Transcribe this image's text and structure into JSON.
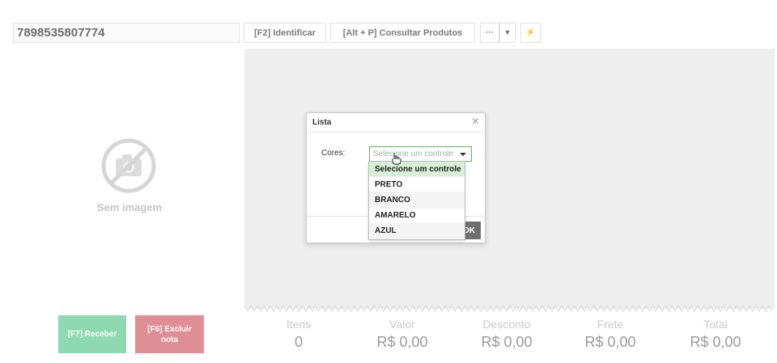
{
  "toolbar": {
    "barcode_value": "7898535807774",
    "identify_label": "[F2] Identificar",
    "consult_label": "[Alt + P] Consultar Produtos",
    "more_label": "···",
    "caret_label": "▾",
    "bolt_label": "⚡"
  },
  "image_area": {
    "no_image_label": "Sem imagem",
    "icon": "no-image-camera-icon"
  },
  "actions": {
    "receive_label": "[F7] Receber",
    "delete_label": "[F6] Excluir nota",
    "receive_color": "#8fd9b0",
    "delete_color": "#e08e96"
  },
  "totals": [
    {
      "label": "Itens",
      "value": "0"
    },
    {
      "label": "Valor",
      "value": "R$ 0,00"
    },
    {
      "label": "Desconto",
      "value": "R$ 0,00"
    },
    {
      "label": "Frete",
      "value": "R$ 0,00"
    },
    {
      "label": "Total",
      "value": "R$ 0,00"
    }
  ],
  "modal": {
    "title": "Lista",
    "close_label": "×",
    "field_label": "Cores:",
    "select_placeholder": "Selecione um controle",
    "ok_label": "OK",
    "options": [
      "Selecione um controle",
      "PRETO",
      "BRANCO",
      "AMARELO",
      "AZUL"
    ],
    "focus_color": "#5cb85c"
  }
}
